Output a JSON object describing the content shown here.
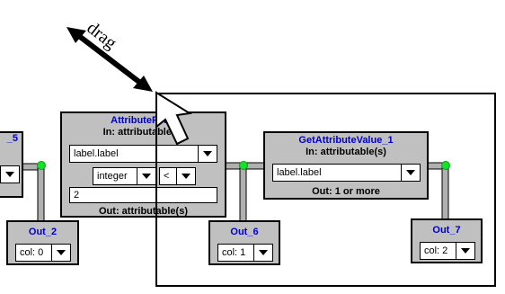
{
  "drag_label": "drag",
  "colors": {
    "title": "#0000cc",
    "box_bg": "#c0c0c0",
    "port": "#17e02a"
  },
  "left_partial": {
    "title": "_5"
  },
  "filter": {
    "title": "AttributeFilter",
    "in_label": "In: attributable(s)",
    "attr_value": "label.label",
    "type_value": "integer",
    "op_value": "<",
    "text_value": "2",
    "out_label": "Out: attributable(s)"
  },
  "getattr": {
    "title": "GetAttributeValue_1",
    "in_label": "In: attributable(s)",
    "attr_value": "label.label",
    "out_label": "Out: 1 or more"
  },
  "out2": {
    "title": "Out_2",
    "col_value": "col: 0"
  },
  "out6": {
    "title": "Out_6",
    "col_value": "col: 1"
  },
  "out7": {
    "title": "Out_7",
    "col_value": "col: 2"
  }
}
